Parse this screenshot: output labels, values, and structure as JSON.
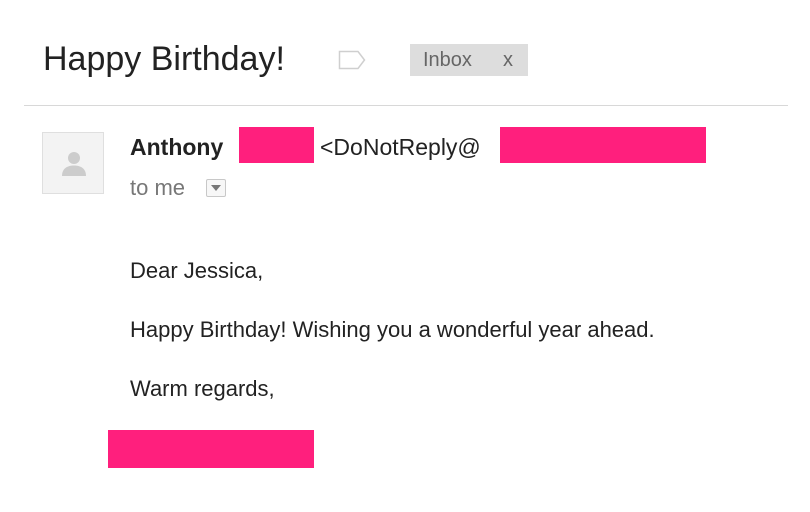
{
  "email": {
    "subject": "Happy Birthday!",
    "label_chip": {
      "label": "Inbox",
      "close": "x"
    },
    "sender": {
      "name": "Anthony",
      "email_prefix": "<DoNotReply@"
    },
    "recipient_text": "to me",
    "body": {
      "greeting": "Dear Jessica,",
      "message": "Happy Birthday! Wishing you a wonderful year ahead.",
      "closing": "Warm regards,"
    }
  },
  "colors": {
    "redaction": "#ff1f7d",
    "chip_background": "#dddddd",
    "divider": "#d8d8d8"
  },
  "icons": [
    "label-tag-icon",
    "person-icon",
    "chevron-down-icon"
  ]
}
